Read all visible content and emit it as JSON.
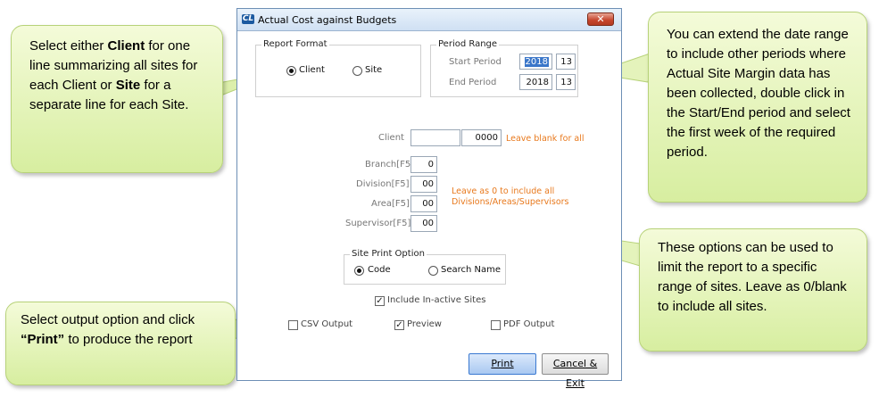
{
  "dialog": {
    "title": "Actual Cost against Budgets",
    "app_icon": "CL",
    "close_label": "✕"
  },
  "report_format": {
    "legend": "Report Format",
    "options": [
      {
        "label": "Client",
        "selected": true
      },
      {
        "label": "Site",
        "selected": false
      }
    ]
  },
  "period_range": {
    "legend": "Period Range",
    "start_label": "Start Period",
    "start_year": "2018",
    "start_week": "13",
    "end_label": "End Period",
    "end_year": "2018",
    "end_week": "13"
  },
  "client": {
    "label": "Client",
    "name_value": "",
    "code_value": "0000",
    "hint": "Leave blank for all"
  },
  "filters": {
    "branch_label": "Branch[F5]",
    "branch_value": "0",
    "division_label": "Division[F5]",
    "division_value": "00",
    "area_label": "Area[F5]",
    "area_value": "00",
    "supervisor_label": "Supervisor[F5]",
    "supervisor_value": "00",
    "hint_line1": "Leave as 0 to include all",
    "hint_line2": "Divisions/Areas/Supervisors"
  },
  "site_print_option": {
    "legend": "Site Print Option",
    "options": [
      {
        "label": "Code",
        "selected": true
      },
      {
        "label": "Search Name",
        "selected": false
      }
    ]
  },
  "include_inactive": {
    "label": "Include In-active Sites",
    "checked": true
  },
  "outputs": [
    {
      "label": "CSV Output",
      "checked": false
    },
    {
      "label": "Preview",
      "checked": true
    },
    {
      "label": "PDF Output",
      "checked": false
    }
  ],
  "buttons": {
    "print": "Print",
    "cancel": "Cancel & Exit"
  },
  "callouts": {
    "report_format": {
      "t1": "Select either ",
      "b1": "Client",
      "t2": " for one line summarizing all sites for each Client or ",
      "b2": "Site",
      "t3": " for a separate line for each Site."
    },
    "period": {
      "text": "You can extend the date range to include other periods where Actual Site Margin data has been collected, double click in the Start/End period and select the first week of the required period."
    },
    "options": {
      "text": "These options can be used to limit the report to a specific range of sites. Leave as 0/blank to include all sites."
    },
    "output": {
      "t1": "Select output option and click ",
      "b1": "“Print”",
      "t2": " to produce the report"
    }
  },
  "colors": {
    "callout_fill": "#dcefab",
    "orange_hint": "#e8791d",
    "print_button_border": "#3a79d1"
  }
}
